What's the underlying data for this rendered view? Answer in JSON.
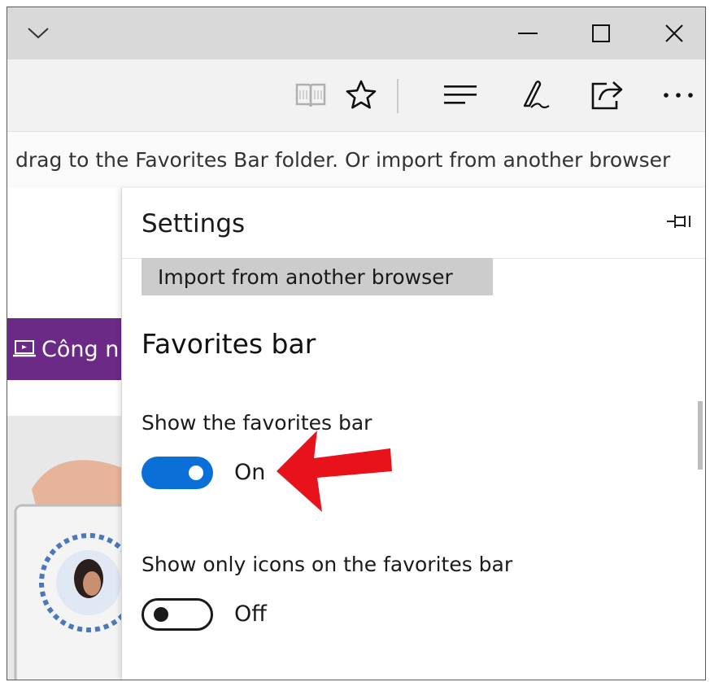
{
  "window": {
    "icons": [
      "chevron-down-icon",
      "minimize-icon",
      "maximize-icon",
      "close-icon"
    ]
  },
  "toolbar": {
    "icons": [
      "reading-view-icon",
      "favorite-star-icon",
      "hub-icon",
      "web-note-icon",
      "share-icon",
      "more-icon"
    ]
  },
  "favorites_hint": {
    "text": "drag to the Favorites Bar folder. Or import from another browser"
  },
  "page": {
    "nav_label": "Công n"
  },
  "settings": {
    "title": "Settings",
    "import_button": "Import from another browser",
    "section_title": "Favorites bar",
    "show_favorites_bar": {
      "label": "Show the favorites bar",
      "state": "On"
    },
    "show_only_icons": {
      "label": "Show only icons on the favorites bar",
      "state": "Off"
    }
  },
  "colors": {
    "toggle_on": "#0a6fd6",
    "annotation_arrow": "#e8121b",
    "nav_purple": "#6a2a86"
  }
}
